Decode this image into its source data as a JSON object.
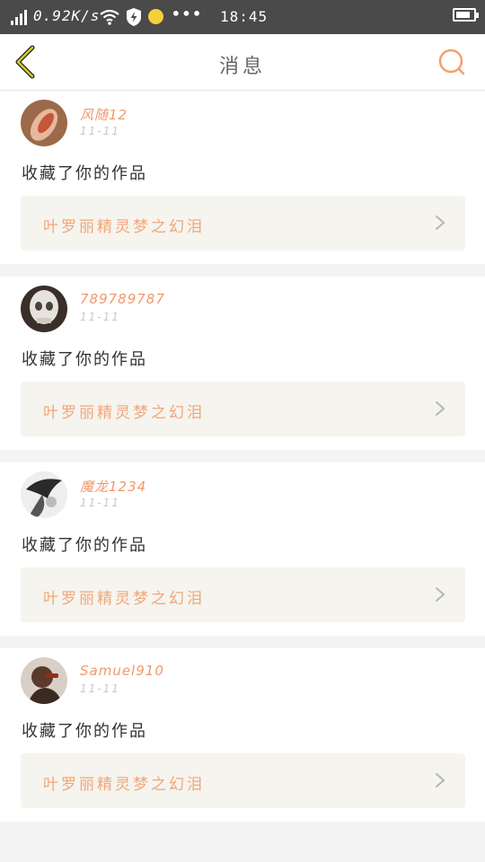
{
  "status_bar": {
    "speed": "0.92K/s",
    "time": "18:45",
    "more": "•••",
    "battery_level": 0.85
  },
  "header": {
    "title": "消息",
    "accent_color": "#f4a06c",
    "back_color": "#c9c22a"
  },
  "messages": [
    {
      "username": "风随12",
      "date": "11-11",
      "action": "收藏了你的作品",
      "work_title": "叶罗丽精灵梦之幻泪"
    },
    {
      "username": "789789787",
      "date": "11-11",
      "action": "收藏了你的作品",
      "work_title": "叶罗丽精灵梦之幻泪"
    },
    {
      "username": "魔龙1234",
      "date": "11-11",
      "action": "收藏了你的作品",
      "work_title": "叶罗丽精灵梦之幻泪"
    },
    {
      "username": "Samuel910",
      "date": "11-11",
      "action": "收藏了你的作品",
      "work_title": "叶罗丽精灵梦之幻泪"
    }
  ]
}
